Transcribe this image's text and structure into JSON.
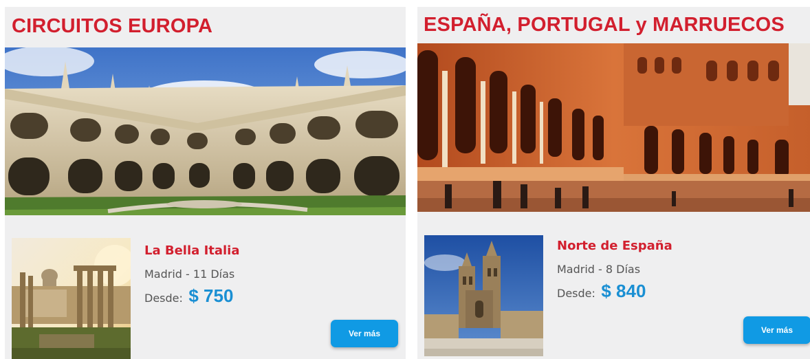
{
  "sections": [
    {
      "title": "CIRCUITOS EUROPA",
      "tour": {
        "name": "La Bella Italia",
        "meta": "Madrid - 11 Días",
        "price_label": "Desde:",
        "price": "$ 750",
        "button": "Ver más"
      }
    },
    {
      "title": "ESPAÑA, PORTUGAL y MARRUECOS",
      "tour": {
        "name": "Norte de España",
        "meta": "Madrid - 8 Días",
        "price_label": "Desde:",
        "price": "$ 840",
        "button": "Ver más"
      }
    }
  ],
  "colors": {
    "title_red": "#d21f2e",
    "price_blue": "#1a8fd3",
    "button_blue": "#109ae4",
    "panel_bg": "#efeff0"
  }
}
